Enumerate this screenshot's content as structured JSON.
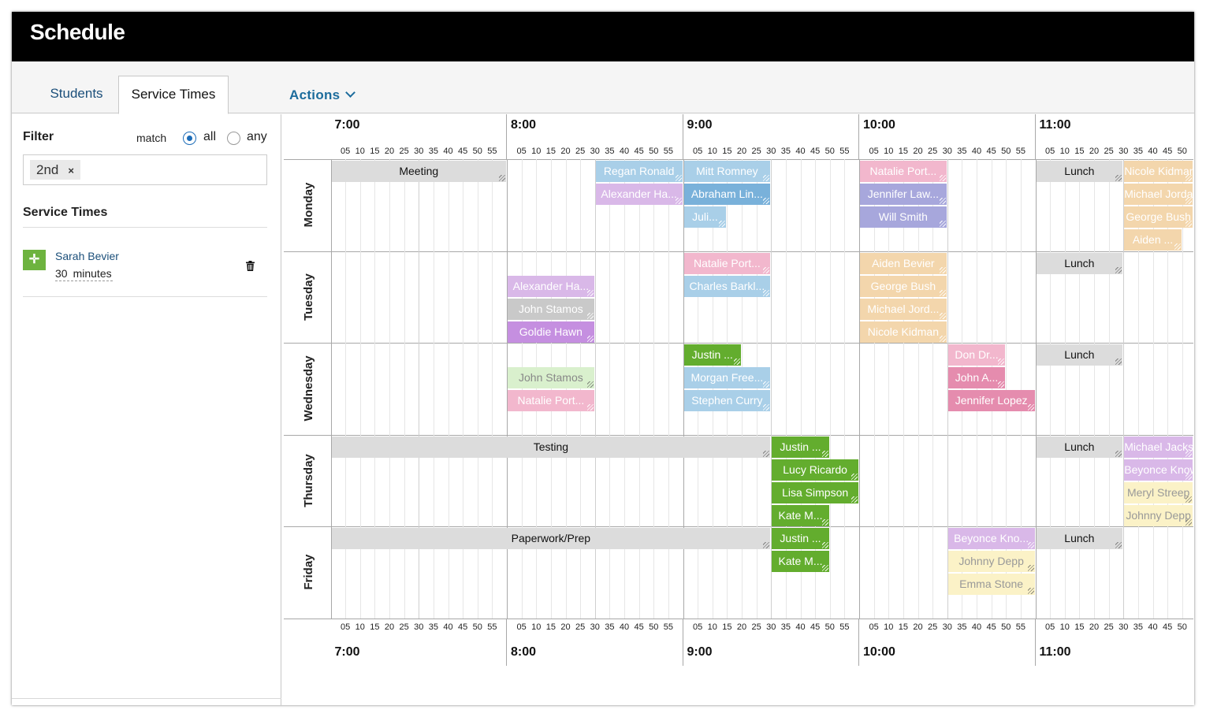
{
  "app": {
    "title": "Schedule"
  },
  "tabs": [
    {
      "label": "Students"
    },
    {
      "label": "Service Times"
    }
  ],
  "actions": {
    "label": "Actions"
  },
  "sidebar": {
    "filter_label": "Filter",
    "match_label": "match",
    "match_options": [
      "all",
      "any"
    ],
    "match_selected": "all",
    "filter_chip": "2nd",
    "chip_remove": "×",
    "service_times_heading": "Service Times",
    "service": {
      "name": "Sarah Bevier",
      "duration_value": "30",
      "duration_unit": "minutes"
    }
  },
  "hours": [
    "7:00",
    "8:00",
    "9:00",
    "10:00",
    "11:00"
  ],
  "minute_ticks": [
    "05",
    "10",
    "15",
    "20",
    "25",
    "30",
    "35",
    "40",
    "45",
    "50",
    "55"
  ],
  "days": [
    "Monday",
    "Tuesday",
    "Wednesday",
    "Thursday",
    "Friday"
  ],
  "events": [
    {
      "day": 0,
      "row": 0,
      "start": "7:00",
      "end": "8:00",
      "label": "Meeting",
      "style": "gray"
    },
    {
      "day": 0,
      "row": 0,
      "start": "8:30",
      "end": "9:00",
      "label": "Regan Ronald",
      "style": "blue"
    },
    {
      "day": 0,
      "row": 1,
      "start": "8:30",
      "end": "9:00",
      "label": "Alexander Ha...",
      "style": "purple"
    },
    {
      "day": 0,
      "row": 0,
      "start": "9:00",
      "end": "9:30",
      "label": "Mitt Romney",
      "style": "blue"
    },
    {
      "day": 0,
      "row": 1,
      "start": "9:00",
      "end": "9:30",
      "label": "Abraham Lin...",
      "style": "blue2"
    },
    {
      "day": 0,
      "row": 2,
      "start": "9:00",
      "end": "9:15",
      "label": "Juli...",
      "style": "blue"
    },
    {
      "day": 0,
      "row": 0,
      "start": "10:00",
      "end": "10:30",
      "label": "Natalie Port...",
      "style": "pink"
    },
    {
      "day": 0,
      "row": 1,
      "start": "10:00",
      "end": "10:30",
      "label": "Jennifer Law...",
      "style": "indigo"
    },
    {
      "day": 0,
      "row": 2,
      "start": "10:00",
      "end": "10:30",
      "label": "Will Smith",
      "style": "indigo"
    },
    {
      "day": 0,
      "row": 0,
      "start": "11:00",
      "end": "11:30",
      "label": "Lunch",
      "style": "gray"
    },
    {
      "day": 0,
      "row": 0,
      "start": "11:30",
      "end": "12:00",
      "label": "Nicole Kidman",
      "style": "orange"
    },
    {
      "day": 0,
      "row": 1,
      "start": "11:30",
      "end": "12:00",
      "label": "Michael Jordan",
      "style": "orange"
    },
    {
      "day": 0,
      "row": 2,
      "start": "11:30",
      "end": "12:00",
      "label": "George Bush",
      "style": "orange"
    },
    {
      "day": 0,
      "row": 3,
      "start": "11:30",
      "end": "11:50",
      "label": "Aiden ...",
      "style": "orange"
    },
    {
      "day": 1,
      "row": 0,
      "start": "9:00",
      "end": "9:30",
      "label": "Natalie Port...",
      "style": "pink"
    },
    {
      "day": 1,
      "row": 1,
      "start": "9:00",
      "end": "9:30",
      "label": "Charles Barkl...",
      "style": "blue"
    },
    {
      "day": 1,
      "row": 1,
      "start": "8:00",
      "end": "8:30",
      "label": "Alexander Ha...",
      "style": "purple"
    },
    {
      "day": 1,
      "row": 2,
      "start": "8:00",
      "end": "8:30",
      "label": "John Stamos",
      "style": "silver"
    },
    {
      "day": 1,
      "row": 3,
      "start": "8:00",
      "end": "8:30",
      "label": "Goldie Hawn",
      "style": "purple2"
    },
    {
      "day": 1,
      "row": 0,
      "start": "10:00",
      "end": "10:30",
      "label": "Aiden Bevier",
      "style": "orange"
    },
    {
      "day": 1,
      "row": 1,
      "start": "10:00",
      "end": "10:30",
      "label": "George Bush",
      "style": "orange"
    },
    {
      "day": 1,
      "row": 2,
      "start": "10:00",
      "end": "10:30",
      "label": "Michael Jord...",
      "style": "orange"
    },
    {
      "day": 1,
      "row": 3,
      "start": "10:00",
      "end": "10:30",
      "label": "Nicole Kidman",
      "style": "orange"
    },
    {
      "day": 1,
      "row": 0,
      "start": "11:00",
      "end": "11:30",
      "label": "Lunch",
      "style": "gray"
    },
    {
      "day": 2,
      "row": 0,
      "start": "9:00",
      "end": "9:20",
      "label": "Justin ...",
      "style": "green"
    },
    {
      "day": 2,
      "row": 1,
      "start": "9:00",
      "end": "9:30",
      "label": "Morgan Free...",
      "style": "blue"
    },
    {
      "day": 2,
      "row": 2,
      "start": "9:00",
      "end": "9:30",
      "label": "Stephen Curry",
      "style": "blue"
    },
    {
      "day": 2,
      "row": 1,
      "start": "8:00",
      "end": "8:30",
      "label": "John Stamos",
      "style": "lightgreen"
    },
    {
      "day": 2,
      "row": 2,
      "start": "8:00",
      "end": "8:30",
      "label": "Natalie Port...",
      "style": "pink"
    },
    {
      "day": 2,
      "row": 0,
      "start": "10:30",
      "end": "10:50",
      "label": "Don Dr...",
      "style": "pink"
    },
    {
      "day": 2,
      "row": 1,
      "start": "10:30",
      "end": "10:50",
      "label": "John A...",
      "style": "pink2"
    },
    {
      "day": 2,
      "row": 2,
      "start": "10:30",
      "end": "11:00",
      "label": "Jennifer Lopez",
      "style": "pink2"
    },
    {
      "day": 2,
      "row": 0,
      "start": "11:00",
      "end": "11:30",
      "label": "Lunch",
      "style": "gray"
    },
    {
      "day": 3,
      "row": 0,
      "start": "7:00",
      "end": "9:30",
      "label": "Testing",
      "style": "gray"
    },
    {
      "day": 3,
      "row": 0,
      "start": "9:30",
      "end": "9:50",
      "label": "Justin ...",
      "style": "green"
    },
    {
      "day": 3,
      "row": 1,
      "start": "9:30",
      "end": "10:00",
      "label": "Lucy Ricardo",
      "style": "green"
    },
    {
      "day": 3,
      "row": 2,
      "start": "9:30",
      "end": "10:00",
      "label": "Lisa Simpson",
      "style": "green"
    },
    {
      "day": 3,
      "row": 3,
      "start": "9:30",
      "end": "9:50",
      "label": "Kate M...",
      "style": "green"
    },
    {
      "day": 3,
      "row": 0,
      "start": "11:00",
      "end": "11:30",
      "label": "Lunch",
      "style": "gray"
    },
    {
      "day": 3,
      "row": 0,
      "start": "11:30",
      "end": "12:00",
      "label": "Michael Jackson",
      "style": "purple"
    },
    {
      "day": 3,
      "row": 1,
      "start": "11:30",
      "end": "12:00",
      "label": "Beyonce Knowles",
      "style": "purple"
    },
    {
      "day": 3,
      "row": 2,
      "start": "11:30",
      "end": "12:00",
      "label": "Meryl Streep",
      "style": "yellow"
    },
    {
      "day": 3,
      "row": 3,
      "start": "11:30",
      "end": "12:00",
      "label": "Johnny Depp",
      "style": "yellow"
    },
    {
      "day": 4,
      "row": 0,
      "start": "7:00",
      "end": "9:30",
      "label": "Paperwork/Prep",
      "style": "gray"
    },
    {
      "day": 4,
      "row": 0,
      "start": "9:30",
      "end": "9:50",
      "label": "Justin ...",
      "style": "green"
    },
    {
      "day": 4,
      "row": 1,
      "start": "9:30",
      "end": "9:50",
      "label": "Kate M...",
      "style": "green"
    },
    {
      "day": 4,
      "row": 0,
      "start": "10:30",
      "end": "11:00",
      "label": "Beyonce Kno...",
      "style": "purple"
    },
    {
      "day": 4,
      "row": 1,
      "start": "10:30",
      "end": "11:00",
      "label": "Johnny Depp",
      "style": "yellow"
    },
    {
      "day": 4,
      "row": 2,
      "start": "10:30",
      "end": "11:00",
      "label": "Emma Stone",
      "style": "yellow"
    },
    {
      "day": 4,
      "row": 0,
      "start": "11:00",
      "end": "11:30",
      "label": "Lunch",
      "style": "gray"
    }
  ],
  "colors": {
    "accent": "#1c6cb8",
    "service_handle": "#6db33f",
    "titlebar": "#000000"
  }
}
